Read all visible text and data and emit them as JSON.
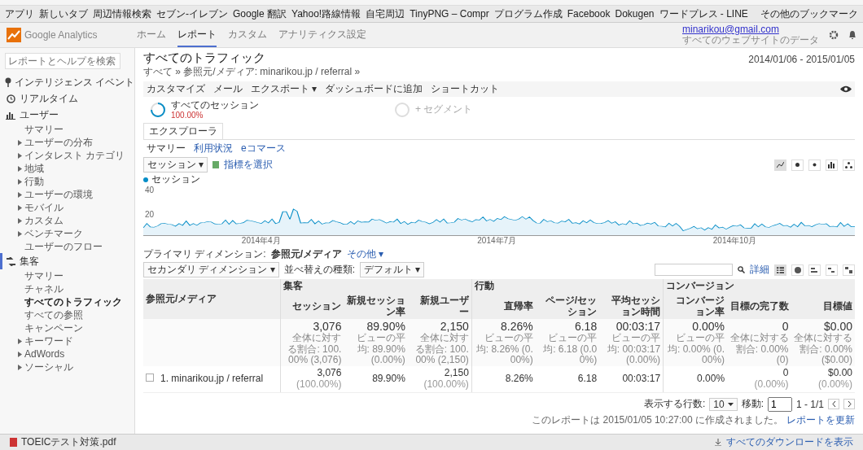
{
  "bookmarks": [
    "アプリ",
    "新しいタブ",
    "周辺情報検索",
    "セブン-イレブン",
    "Google 翻訳",
    "Yahoo!路線情報",
    "自宅周辺",
    "TinyPNG – Compr",
    "プログラム作成",
    "Facebook",
    "Dokugen",
    "ワードプレス - LINE"
  ],
  "other_bookmarks": "その他のブックマーク",
  "header": {
    "logo_text": "Google Analytics",
    "nav": [
      {
        "label": "ホーム",
        "selected": false
      },
      {
        "label": "レポート",
        "selected": true
      },
      {
        "label": "カスタム",
        "selected": false
      },
      {
        "label": "アナリティクス設定",
        "selected": false
      }
    ],
    "account_email": "minarikou@gmail.com",
    "account_property": "すべてのウェブサイトのデータ"
  },
  "sidebar": {
    "search_placeholder": "レポートとヘルプを検索",
    "items": [
      {
        "label": "インテリジェンス イベント",
        "selected": false
      },
      {
        "label": "リアルタイム",
        "selected": false
      },
      {
        "label": "ユーザー",
        "selected": false,
        "children": [
          {
            "label": "サマリー",
            "expandable": false,
            "selected": false
          },
          {
            "label": "ユーザーの分布",
            "expandable": true,
            "selected": false
          },
          {
            "label": "インタレスト カテゴリ",
            "expandable": true,
            "selected": false
          },
          {
            "label": "地域",
            "expandable": true,
            "selected": false
          },
          {
            "label": "行動",
            "expandable": true,
            "selected": false
          },
          {
            "label": "ユーザーの環境",
            "expandable": true,
            "selected": false
          },
          {
            "label": "モバイル",
            "expandable": true,
            "selected": false
          },
          {
            "label": "カスタム",
            "expandable": true,
            "selected": false
          },
          {
            "label": "ベンチマーク",
            "expandable": true,
            "selected": false
          },
          {
            "label": "ユーザーのフロー",
            "expandable": false,
            "selected": false
          }
        ]
      },
      {
        "label": "集客",
        "selected": true,
        "children": [
          {
            "label": "サマリー",
            "expandable": false,
            "selected": false
          },
          {
            "label": "チャネル",
            "expandable": false,
            "selected": false
          },
          {
            "label": "すべてのトラフィック",
            "expandable": false,
            "selected": true
          },
          {
            "label": "すべての参照",
            "expandable": false,
            "selected": false
          },
          {
            "label": "キャンペーン",
            "expandable": false,
            "selected": false
          },
          {
            "label": "キーワード",
            "expandable": true,
            "selected": false
          },
          {
            "label": "AdWords",
            "expandable": true,
            "selected": false
          },
          {
            "label": "ソーシャル",
            "expandable": true,
            "selected": false
          }
        ]
      }
    ]
  },
  "report": {
    "title": "すべてのトラフィック",
    "date_range": "2014/01/06 - 2015/01/05",
    "breadcrumb": "すべて » 参照元/メディア: minarikou.jp / referral »",
    "toolbar": [
      "カスタマイズ",
      "メール",
      "エクスポート ▾",
      "ダッシュボードに追加",
      "ショートカット"
    ],
    "segments": [
      {
        "label": "すべてのセッション",
        "percent": "100.00%",
        "selected": true
      },
      {
        "label": "+ セグメント",
        "selected": false
      }
    ],
    "explorer_tab": "エクスプローラ",
    "subtabs": [
      {
        "label": "サマリー",
        "selected": true
      },
      {
        "label": "利用状況",
        "selected": false
      },
      {
        "label": "eコマース",
        "selected": false
      }
    ],
    "metric_select": "セッション ▾",
    "compare_metric": "指標を選択",
    "legend": "セッション",
    "y_tick_labels": [
      "40",
      "20"
    ],
    "x_labels": [
      "2014年4月",
      "2014年7月",
      "2014年10月"
    ],
    "primary_dimension_label": "プライマリ ディメンション:",
    "primary_dimension": "参照元/メディア",
    "primary_other": "その他 ▾",
    "secondary_dimension": "セカンダリ ディメンション ▾",
    "sort_label": "並べ替えの種類:",
    "sort_value": "デフォルト ▾",
    "advanced": "詳細",
    "table": {
      "dimension_header": "参照元/メディア",
      "groups": [
        "集客",
        "行動",
        "コンバージョン"
      ],
      "columns": [
        "セッション",
        "新規セッション率",
        "新規ユーザー",
        "直帰率",
        "ページ/セッション",
        "平均セッション時間",
        "コンバージョン率",
        "目標の完了数",
        "目標値"
      ],
      "totals": [
        {
          "value": "3,076",
          "note": "全体に対する割合: 100.00% (3,076)"
        },
        {
          "value": "89.90%",
          "note": "ビューの平均: 89.90% (0.00%)"
        },
        {
          "value": "2,150",
          "note": "全体に対する割合: 100.00% (2,150)"
        },
        {
          "value": "8.26%",
          "note": "ビューの平均: 8.26% (0.00%)"
        },
        {
          "value": "6.18",
          "note": "ビューの平均: 6.18 (0.00%)"
        },
        {
          "value": "00:03:17",
          "note": "ビューの平均: 00:03:17 (0.00%)"
        },
        {
          "value": "0.00%",
          "note": "ビューの平均: 0.00% (0.00%)"
        },
        {
          "value": "0",
          "note": "全体に対する割合: 0.00% (0)"
        },
        {
          "value": "$0.00",
          "note": "全体に対する割合: 0.00% ($0.00)"
        }
      ],
      "rows": [
        {
          "index": "1.",
          "checked": false,
          "source": "minarikou.jp / referral",
          "cells": [
            {
              "value": "3,076",
              "share": "(100.00%)"
            },
            {
              "value": "89.90%"
            },
            {
              "value": "2,150",
              "share": "(100.00%)"
            },
            {
              "value": "8.26%"
            },
            {
              "value": "6.18"
            },
            {
              "value": "00:03:17"
            },
            {
              "value": "0.00%"
            },
            {
              "value": "0",
              "share": "(0.00%)"
            },
            {
              "value": "$0.00",
              "share": "(0.00%)"
            }
          ]
        }
      ]
    },
    "pagination": {
      "rows_label": "表示する行数:",
      "rows_value": "10",
      "goto_label": "移動:",
      "goto_value": "1",
      "range": "1 - 1/1"
    },
    "footer_note": "このレポートは 2015/01/05 10:27:00 に作成されました。",
    "refresh_link": "レポートを更新"
  },
  "downloads": {
    "file": "TOEICテスト対策.pdf",
    "show_all": "すべてのダウンロードを表示"
  }
}
